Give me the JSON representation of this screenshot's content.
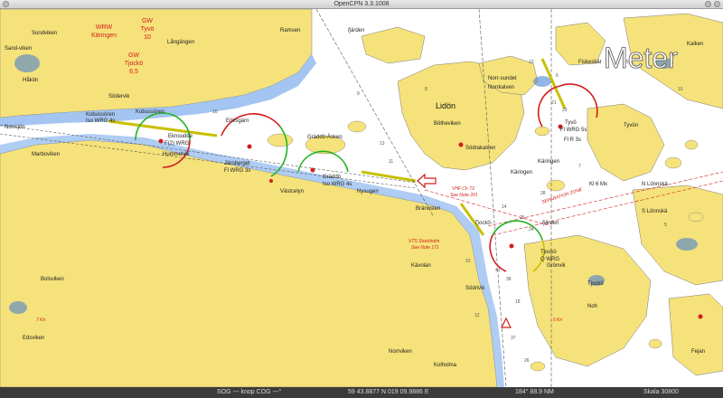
{
  "window": {
    "title": "OpenCPN 3.3.1008"
  },
  "colors": {
    "land": "#f5e27a",
    "shallow": "#8db6ee",
    "deep_shallow": "#3a78d6",
    "water": "#ffffff",
    "sector_red": "#d21d1d",
    "sector_green": "#23b423",
    "sector_white": "#ffffff",
    "fairway": "#c8c000"
  },
  "overlay": {
    "units_label": "Meter"
  },
  "tide_stations": [
    {
      "l1": "WRW",
      "l2": "Käringen"
    },
    {
      "l1": "GW",
      "l2": "Tyvö",
      "l3": "10"
    },
    {
      "l1": "GW",
      "l2": "Tjockö",
      "l3": "6,5"
    }
  ],
  "place_names": {
    "lidon": "Lidön",
    "fjarden_top": "fjärden",
    "tjocko_fjarden": "Tjockö-",
    "fjarden_low": "fjärden",
    "hakon": "Håkön",
    "sundvikbn": "Sundviken",
    "sandvik": "Sand-viken",
    "langangen": "Långängen",
    "ramsen": "Ramsen",
    "norrsund": "Norr-sundet",
    "norrkalven": "Norrkalven",
    "sodersvik": "Södervik",
    "norrsjon": "Norrsjön",
    "marboviken": "Marboviken",
    "hummelvik": "Hummelvik",
    "eriksgarn": "Eriksgärn",
    "graddoasken": "Gräddö-Äsken",
    "vastcelyn": "Västcelyn",
    "nysugen": "Nysugen",
    "brannsten": "Brännsten",
    "kavolan": "Kävolan",
    "sodernvik": "Södrivik",
    "kalken": "Kalken",
    "tyvon": "Tyvön",
    "tjockoe": "Tjockö",
    "gronvik": "Grönvik",
    "noh": "Noh",
    "slonnsk": "S Lönnskä",
    "nlonnsk": "N Lönnskä",
    "fejan": "Fejan",
    "bolsvik": "Bolsviken",
    "ednviken": "Edsviken",
    "kolholma": "Kolholma",
    "norrnviken": "Norrviken",
    "bottenviken": "Bötheviken",
    "sodrakalven": "Södrakalven",
    "fiskeskar": "Fiskeskär",
    "karingen_small": "Käringen"
  },
  "lights": [
    {
      "name": "Kobussören",
      "desc": "Iso WRG 4s"
    },
    {
      "name": "Kobussören",
      "desc": ""
    },
    {
      "name": "Eknoudde",
      "desc": "F(2) WRG"
    },
    {
      "name": "Järnberget",
      "desc": "Fl WRG 3s"
    },
    {
      "name": "Gräddö",
      "desc": "Iso WRG 4s"
    },
    {
      "name": "Tyvö",
      "desc": "Fl WRG 5s"
    },
    {
      "name": "Käringen",
      "desc": ""
    },
    {
      "name": "Kl 6 Mx",
      "desc": ""
    },
    {
      "name": "Tjockö",
      "desc": "Q WRG"
    },
    {
      "name": "Fl R 3s",
      "desc": ""
    }
  ],
  "notes": {
    "vhf": "VHF Ch 73",
    "see201": "See Note 201",
    "vts1": "VTS Stockholm",
    "see171": "See Note 171",
    "separation": "SEPARATION ZONE",
    "nkn": "7 Kn",
    "skn": "5 Kn"
  },
  "depths": [
    "16",
    "9",
    "13",
    "13",
    "6",
    "21",
    "29",
    "14",
    "25",
    "7",
    "28",
    "41",
    "38",
    "12",
    "18",
    "37",
    "26",
    "5",
    "10",
    "15",
    "8",
    "22",
    "11",
    "24"
  ],
  "status": {
    "sog": "SOG --- knop  COG ---°",
    "position": "59 43.8877 N   019 09.9886 E",
    "bearing": "184°  88.9 NM",
    "scale": "Skala 30800"
  }
}
